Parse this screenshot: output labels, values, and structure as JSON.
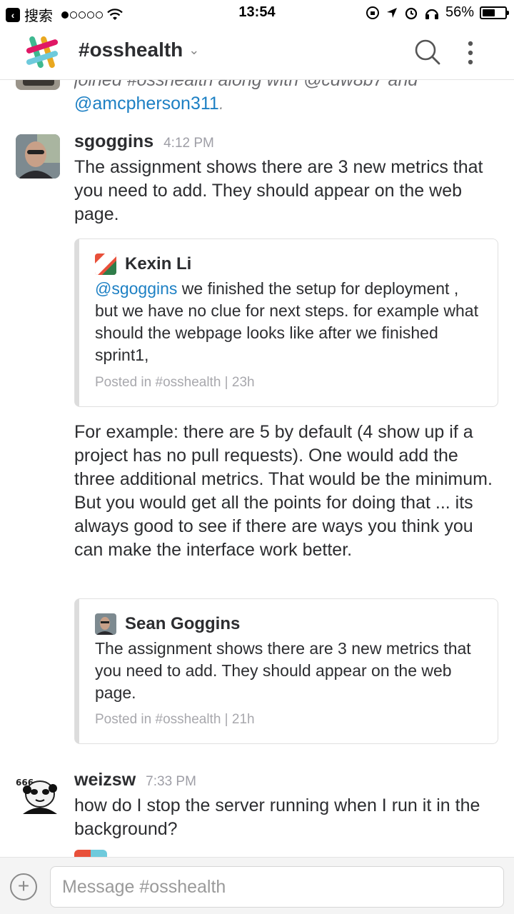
{
  "statusbar": {
    "back_label": "搜索",
    "time": "13:54",
    "battery": "56%",
    "battery_level": 0.56
  },
  "header": {
    "channel": "#osshealth"
  },
  "partial": {
    "line1": "joined #osshealth along with @cdw8b7 and",
    "mention": "@amcpherson311",
    "suffix": "."
  },
  "messages": [
    {
      "user": "sgoggins",
      "time": "4:12 PM",
      "text": "The assignment shows there are 3 new metrics that you need to add. They should appear on the web page."
    },
    {
      "user": "weizsw",
      "time": "7:33 PM",
      "text": "how do I stop the server running when I run it in the background?"
    }
  ],
  "quote1": {
    "author": "Kexin Li",
    "mention": "@sgoggins",
    "text": " we finished the setup for deployment , but we have no clue for next steps. for example what should the webpage looks like after we finished sprint1,",
    "footer": "Posted in #osshealth | 23h"
  },
  "followup": "For example: there are 5 by default (4 show up if a project has no pull requests).  One would add the three additional metrics.  That would be the minimum. But you would get all the points for doing that ... its always good to see if there are ways you think you can make the interface work better.",
  "quote2": {
    "author": "Sean Goggins",
    "text": "The assignment shows there are 3 new metrics that you need to add. They should appear on the web page.",
    "footer": "Posted in #osshealth | 21h"
  },
  "composer": {
    "placeholder": "Message #osshealth"
  },
  "colors": {
    "mention": "#1d80c4",
    "timestamp": "#9e9ea6"
  }
}
